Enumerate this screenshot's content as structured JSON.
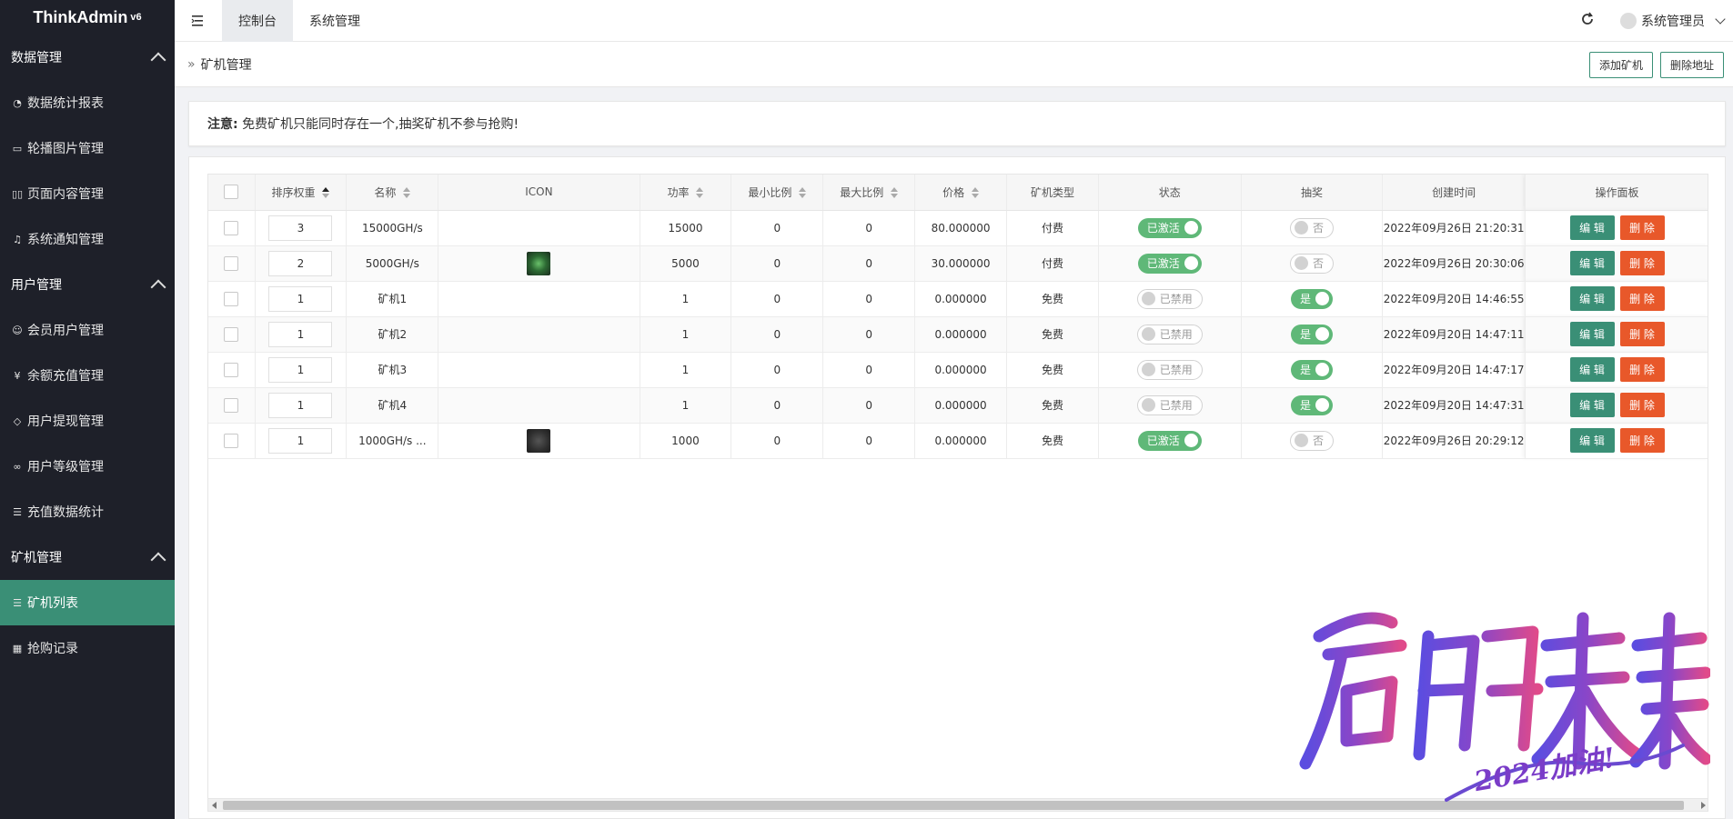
{
  "brand": {
    "name": "ThinkAdmin",
    "version": "v6"
  },
  "sidebar": {
    "groups": [
      {
        "label": "数据管理",
        "items": [
          {
            "label": "数据统计报表",
            "icon": "dashboard-icon"
          },
          {
            "label": "轮播图片管理",
            "icon": "image-icon"
          },
          {
            "label": "页面内容管理",
            "icon": "book-icon"
          },
          {
            "label": "系统通知管理",
            "icon": "bell-icon"
          }
        ]
      },
      {
        "label": "用户管理",
        "items": [
          {
            "label": "会员用户管理",
            "icon": "user-icon"
          },
          {
            "label": "余额充值管理",
            "icon": "yen-icon"
          },
          {
            "label": "用户提现管理",
            "icon": "cube-icon"
          },
          {
            "label": "用户等级管理",
            "icon": "link-icon"
          },
          {
            "label": "充值数据统计",
            "icon": "list-icon"
          }
        ]
      },
      {
        "label": "矿机管理",
        "items": [
          {
            "label": "矿机列表",
            "icon": "list-icon",
            "active": true
          },
          {
            "label": "抢购记录",
            "icon": "calendar-icon"
          }
        ]
      }
    ]
  },
  "topbar": {
    "tabs": [
      {
        "label": "控制台",
        "active": true
      },
      {
        "label": "系统管理",
        "active": false
      }
    ],
    "user": "系统管理员"
  },
  "breadcrumb": {
    "title": "矿机管理",
    "buttons": {
      "add": "添加矿机",
      "delete": "删除地址"
    }
  },
  "notice": {
    "label": "注意:",
    "text": "免费矿机只能同时存在一个,抽奖矿机不参与抢购!"
  },
  "table": {
    "headers": {
      "sort": "排序权重",
      "name": "名称",
      "icon": "ICON",
      "power": "功率",
      "min_ratio": "最小比例",
      "max_ratio": "最大比例",
      "price": "价格",
      "type": "矿机类型",
      "status": "状态",
      "lottery": "抽奖",
      "created": "创建时间",
      "actions": "操作面板"
    },
    "action_labels": {
      "edit": "编 辑",
      "delete": "删 除"
    },
    "rows": [
      {
        "sort": "3",
        "name": "15000GH/s",
        "thumb": "",
        "power": "15000",
        "min": "0",
        "max": "0",
        "price": "80.000000",
        "type": "付费",
        "status": "已激活",
        "status_on": true,
        "lottery": "否",
        "lottery_on": false,
        "created": "2022年09月26日 21:20:31"
      },
      {
        "sort": "2",
        "name": "5000GH/s",
        "thumb": "green",
        "power": "5000",
        "min": "0",
        "max": "0",
        "price": "30.000000",
        "type": "付费",
        "status": "已激活",
        "status_on": true,
        "lottery": "否",
        "lottery_on": false,
        "created": "2022年09月26日 20:30:06"
      },
      {
        "sort": "1",
        "name": "矿机1",
        "thumb": "",
        "power": "1",
        "min": "0",
        "max": "0",
        "price": "0.000000",
        "type": "免费",
        "status": "已禁用",
        "status_on": false,
        "lottery": "是",
        "lottery_on": true,
        "created": "2022年09月20日 14:46:55"
      },
      {
        "sort": "1",
        "name": "矿机2",
        "thumb": "",
        "power": "1",
        "min": "0",
        "max": "0",
        "price": "0.000000",
        "type": "免费",
        "status": "已禁用",
        "status_on": false,
        "lottery": "是",
        "lottery_on": true,
        "created": "2022年09月20日 14:47:11"
      },
      {
        "sort": "1",
        "name": "矿机3",
        "thumb": "",
        "power": "1",
        "min": "0",
        "max": "0",
        "price": "0.000000",
        "type": "免费",
        "status": "已禁用",
        "status_on": false,
        "lottery": "是",
        "lottery_on": true,
        "created": "2022年09月20日 14:47:17"
      },
      {
        "sort": "1",
        "name": "矿机4",
        "thumb": "",
        "power": "1",
        "min": "0",
        "max": "0",
        "price": "0.000000",
        "type": "免费",
        "status": "已禁用",
        "status_on": false,
        "lottery": "是",
        "lottery_on": true,
        "created": "2022年09月20日 14:47:31"
      },
      {
        "sort": "1",
        "name": "1000GH/s ...",
        "thumb": "dark",
        "power": "1000",
        "min": "0",
        "max": "0",
        "price": "0.000000",
        "type": "免费",
        "status": "已激活",
        "status_on": true,
        "lottery": "否",
        "lottery_on": false,
        "created": "2022年09月26日 20:29:12"
      }
    ]
  },
  "watermark": {
    "main": "启航未来",
    "sub": "2024加油!"
  },
  "colors": {
    "sidebar_bg": "#1e2029",
    "accent": "#3a8f76",
    "danger": "#e8582a",
    "switch_on": "#5fb878"
  }
}
